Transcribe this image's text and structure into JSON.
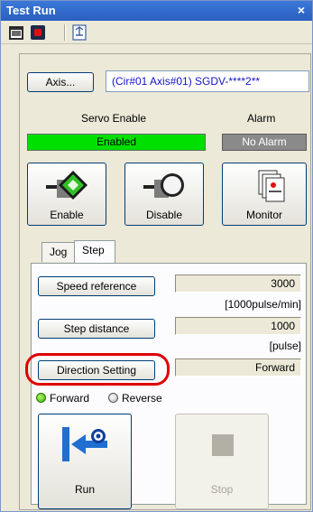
{
  "window": {
    "title": "Test Run",
    "close_glyph": "×"
  },
  "toolbar": {
    "icons": [
      "calendar-icon",
      "record-icon",
      "refresh-icon"
    ]
  },
  "axis": {
    "button_label": "Axis...",
    "info": "(Cir#01 Axis#01) SGDV-****2**"
  },
  "servo": {
    "heading": "Servo Enable",
    "status": "Enabled",
    "status_color": "#00e000"
  },
  "alarm": {
    "heading": "Alarm",
    "status": "No Alarm",
    "status_color": "#8a8a8a"
  },
  "buttons": {
    "enable": "Enable",
    "disable": "Disable",
    "monitor": "Monitor"
  },
  "tabs": {
    "jog": "Jog",
    "step": "Step"
  },
  "step": {
    "speed_button": "Speed reference",
    "speed_value": "3000",
    "speed_unit": "[1000pulse/min]",
    "distance_button": "Step distance",
    "distance_value": "1000",
    "distance_unit": "[pulse]",
    "direction_button": "Direction Setting",
    "direction_value": "Forward",
    "radio_forward": "Forward",
    "radio_reverse": "Reverse"
  },
  "actions": {
    "run": "Run",
    "stop": "Stop"
  }
}
